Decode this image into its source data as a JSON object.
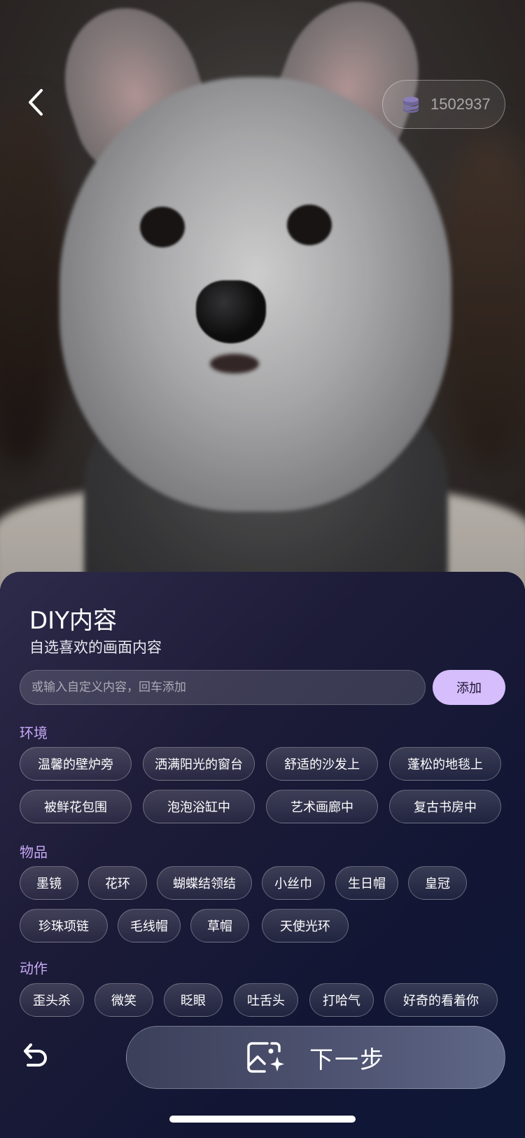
{
  "header": {
    "coins": "1502937"
  },
  "sheet": {
    "title": "DIY内容",
    "subtitle": "自选喜欢的画面内容",
    "input_placeholder": "或输入自定义内容，回车添加",
    "add_label": "添加"
  },
  "sections": [
    {
      "label": "环境",
      "chips": [
        "温馨的壁炉旁",
        "洒满阳光的窗台",
        "舒适的沙发上",
        "蓬松的地毯上",
        "被鲜花包围",
        "泡泡浴缸中",
        "艺术画廊中",
        "复古书房中"
      ]
    },
    {
      "label": "物品",
      "chips": [
        "墨镜",
        "花环",
        "蝴蝶结领结",
        "小丝巾",
        "生日帽",
        "皇冠",
        "珍珠项链",
        "毛线帽",
        "草帽",
        "天使光环"
      ]
    },
    {
      "label": "动作",
      "chips": [
        "歪头杀",
        "微笑",
        "眨眼",
        "吐舌头",
        "打哈气",
        "好奇的看着你"
      ]
    }
  ],
  "footer": {
    "next_label": "下一步"
  },
  "icons": {
    "back": "chevron-left-icon",
    "coins": "coin-stack-icon",
    "undo": "undo-icon",
    "next": "image-sparkle-icon"
  },
  "colors": {
    "accent": "#d6bdfb",
    "section_label": "#c7a8f5"
  }
}
